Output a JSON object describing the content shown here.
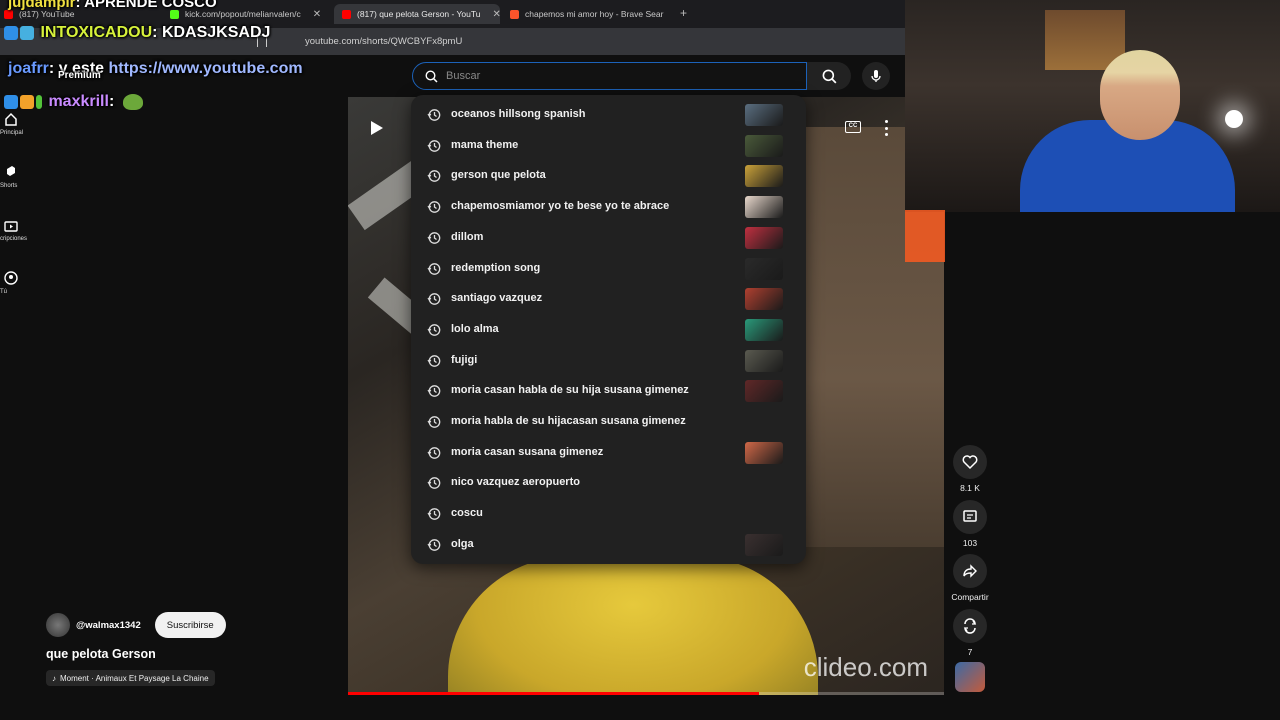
{
  "browser": {
    "tabs": [
      {
        "title": "(817) YouTube",
        "active": false,
        "color": "#ff0000"
      },
      {
        "title": "kick.com/popout/melianvalen/c",
        "active": false,
        "color": "#53fc18"
      },
      {
        "title": "(817) que pelota Gerson - YouTu",
        "active": true,
        "color": "#ff0000"
      },
      {
        "title": "chapemos mi amor hoy - Brave Sear",
        "active": false,
        "color": "#fb542b"
      }
    ],
    "url": "youtube.com/shorts/QWCBYFx8pmU"
  },
  "chat": {
    "line1": {
      "user": "jujdampir",
      "text": ": APRENDE COSCO"
    },
    "line2": {
      "user": "INTOXICADOU",
      "text": ": KDASJKSADJ"
    },
    "line3": {
      "user": "joafrr",
      "text": ": y este ",
      "link": "https://www.youtube.com"
    },
    "line4": {
      "user": "maxkrill",
      "text": ":"
    },
    "premium_label": "Premium"
  },
  "search": {
    "placeholder": "Buscar",
    "suggestions": [
      {
        "text": "oceanos hillsong spanish",
        "thumb": "#5a6e80"
      },
      {
        "text": "mama theme",
        "thumb": "#4a5a3a"
      },
      {
        "text": "gerson que pelota",
        "thumb": "#caa23a"
      },
      {
        "text": "chapemosmiamor yo te bese yo te abrace",
        "thumb": "#e8d8cc"
      },
      {
        "text": "dillom",
        "thumb": "#c03040"
      },
      {
        "text": "redemption song",
        "thumb": "#2a2a2a"
      },
      {
        "text": "santiago vazquez",
        "thumb": "#b04030"
      },
      {
        "text": "lolo alma",
        "thumb": "#2a9a7a"
      },
      {
        "text": "fujigi",
        "thumb": "#5a5a50"
      },
      {
        "text": "moria casan habla de su hija susana gimenez",
        "thumb": "#602828"
      },
      {
        "text": "moria habla de su hijacasan susana gimenez",
        "thumb": ""
      },
      {
        "text": "moria casan susana gimenez",
        "thumb": "#d06848"
      },
      {
        "text": "nico vazquez aeropuerto",
        "thumb": ""
      },
      {
        "text": "coscu",
        "thumb": ""
      },
      {
        "text": "olga",
        "thumb": "#3a3030"
      }
    ]
  },
  "sidebar": {
    "items": [
      {
        "label": "Principal",
        "icon": "home-icon"
      },
      {
        "label": "Shorts",
        "icon": "shorts-icon"
      },
      {
        "label": "cripciones",
        "icon": "subscriptions-icon"
      },
      {
        "label": "Tú",
        "icon": "you-icon"
      }
    ]
  },
  "video": {
    "watermark": "clideo.com",
    "progress": 0.69
  },
  "actions": {
    "likes": "8.1 K",
    "comments": "103",
    "share": "Compartir",
    "remix": "7"
  },
  "short": {
    "channel": "@walmax1342",
    "subscribe": "Suscribirse",
    "title": "que pelota Gerson",
    "music": "Moment · Animaux Et Paysage La Chaine"
  }
}
